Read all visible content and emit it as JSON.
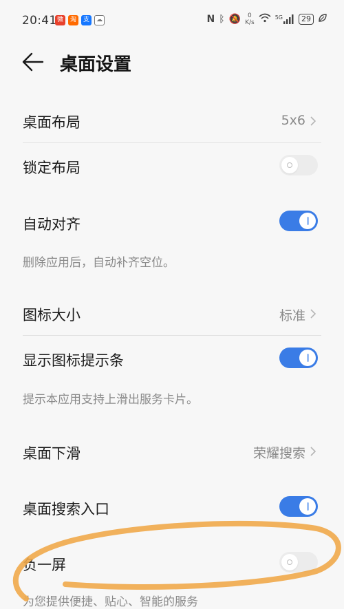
{
  "status_bar": {
    "time": "20:41",
    "netspeed_value": "0",
    "netspeed_unit": "K/s",
    "network": "5G",
    "battery": "29",
    "app_icons": [
      "weibo-icon",
      "taobao-icon",
      "alipay-icon",
      "cloud-app-icon"
    ],
    "system_icons": [
      "nfc-icon",
      "bluetooth-icon",
      "mute-icon",
      "wifi-icon",
      "signal-icon",
      "battery-icon",
      "leaf-icon"
    ]
  },
  "header": {
    "title": "桌面设置"
  },
  "settings": [
    {
      "label": "桌面布局",
      "value": "5x6"
    },
    {
      "label": "锁定布局",
      "toggle": false
    },
    {
      "label": "自动对齐",
      "toggle": true,
      "desc": "删除应用后，自动补齐空位。"
    },
    {
      "label": "图标大小",
      "value": "标准"
    },
    {
      "label": "显示图标提示条",
      "toggle": true,
      "desc": "提示本应用支持上滑出服务卡片。"
    },
    {
      "label": "桌面下滑",
      "value": "荣耀搜索"
    },
    {
      "label": "桌面搜索入口",
      "toggle": true
    },
    {
      "label": "负一屏",
      "toggle": false,
      "desc": "为您提供便捷、贴心、智能的服务"
    }
  ],
  "colors": {
    "accent": "#3a7ce6",
    "background": "#f7f7f7",
    "annotation": "#f0a94a"
  }
}
